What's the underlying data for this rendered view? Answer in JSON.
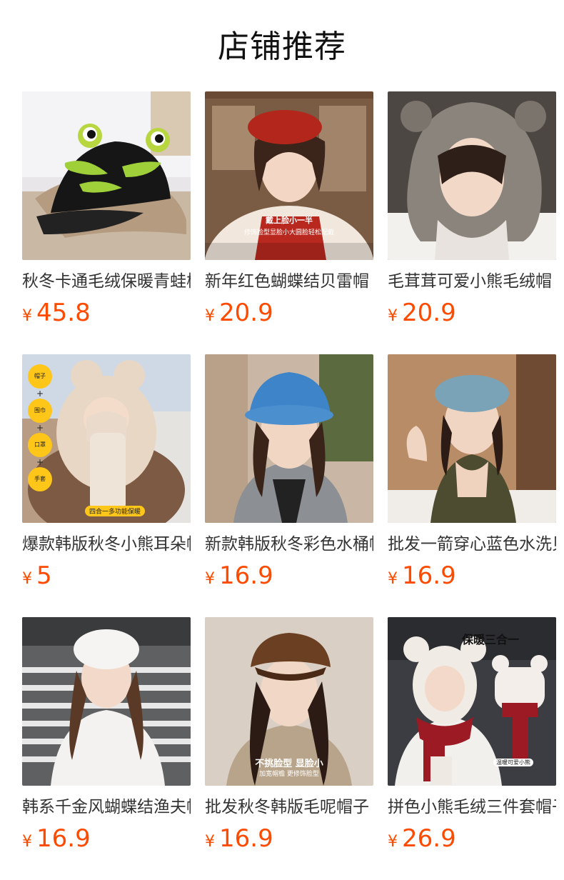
{
  "section_title": "店铺推荐",
  "currency": "¥",
  "products": [
    {
      "name": "秋冬卡通毛绒保暖青蛙棒球帽",
      "price": "45.8",
      "image": "frog-cap-image"
    },
    {
      "name": "新年红色蝴蝶结贝雷帽",
      "price": "20.9",
      "image": "red-beret-image",
      "overlay_title": "戴上脸小一半",
      "overlay_sub": "修饰脸型显脸小大圆脸轻松配戴"
    },
    {
      "name": "毛茸茸可爱小熊毛绒帽",
      "price": "20.9",
      "image": "fluffy-bear-hat-image"
    },
    {
      "name": "爆款韩版秋冬小熊耳朵帽子",
      "price": "5",
      "image": "bear-ear-hat-image",
      "badges": [
        "帽子",
        "围巾",
        "口罩",
        "手套"
      ],
      "overlay_sub": "四合一多功能保暖"
    },
    {
      "name": "新款韩版秋冬彩色水桶帽",
      "price": "16.9",
      "image": "blue-bucket-hat-image"
    },
    {
      "name": "批发一箭穿心蓝色水洗贝雷帽",
      "price": "16.9",
      "image": "denim-beret-image"
    },
    {
      "name": "韩系千金风蝴蝶结渔夫帽",
      "price": "16.9",
      "image": "white-beret-image"
    },
    {
      "name": "批发秋冬韩版毛呢帽子",
      "price": "16.9",
      "image": "brown-newsboy-cap-image",
      "overlay_title": "不挑脸型 显脸小",
      "overlay_sub": "加宽帽檐 更修饰脸型"
    },
    {
      "name": "拼色小熊毛绒三件套帽子",
      "price": "26.9",
      "image": "bear-three-set-image",
      "overlay_title": "保暖三合一",
      "overlay_sub": "温暖可爱小熊"
    }
  ]
}
